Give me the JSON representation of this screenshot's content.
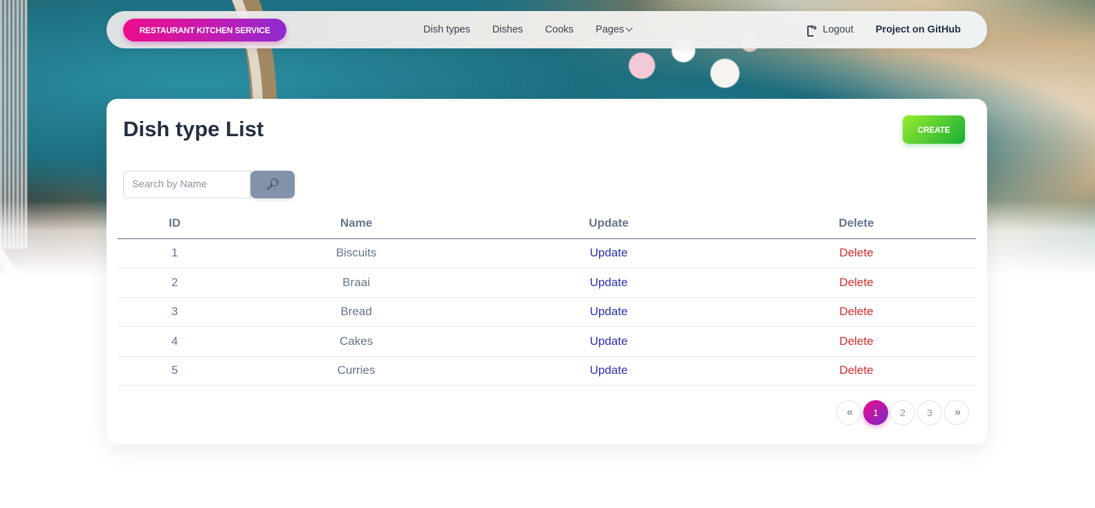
{
  "navbar": {
    "brand": "RESTAURANT KITCHEN SERVICE",
    "links": [
      "Dish types",
      "Dishes",
      "Cooks",
      "Pages"
    ],
    "logout": "Logout",
    "github": "Project on GitHub"
  },
  "page": {
    "title": "Dish type List",
    "create_label": "CREATE",
    "search_placeholder": "Search by Name"
  },
  "table": {
    "headers": [
      "ID",
      "Name",
      "Update",
      "Delete"
    ],
    "rows": [
      {
        "id": "1",
        "name": "Biscuits",
        "update": "Update",
        "delete": "Delete"
      },
      {
        "id": "2",
        "name": "Braai",
        "update": "Update",
        "delete": "Delete"
      },
      {
        "id": "3",
        "name": "Bread",
        "update": "Update",
        "delete": "Delete"
      },
      {
        "id": "4",
        "name": "Cakes",
        "update": "Update",
        "delete": "Delete"
      },
      {
        "id": "5",
        "name": "Curries",
        "update": "Update",
        "delete": "Delete"
      }
    ]
  },
  "pagination": {
    "first": "«",
    "pages": [
      "1",
      "2",
      "3"
    ],
    "current": "1",
    "last": "»"
  },
  "colors": {
    "brand_gradient_start": "#ec0c8c",
    "brand_gradient_end": "#8c2bd1",
    "create_gradient_start": "#98ec2d",
    "create_gradient_end": "#17ad37",
    "update_link": "#2b2fb3",
    "delete_link": "#d42a2a"
  },
  "icons": {
    "logout": "logout-icon",
    "search": "search-icon",
    "pages_dropdown": "chevron-down-icon"
  }
}
